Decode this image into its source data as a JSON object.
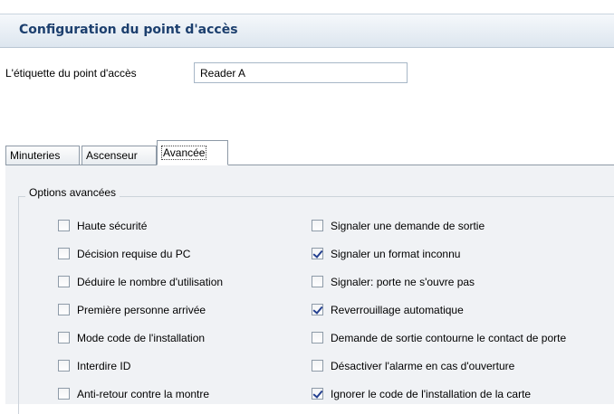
{
  "header": {
    "title": "Configuration du point d'accès"
  },
  "access_point": {
    "label": "L'étiquette du point d'accès",
    "value": "Reader A"
  },
  "tabs": [
    {
      "label": "Minuteries",
      "active": false
    },
    {
      "label": "Ascenseur",
      "active": false
    },
    {
      "label": "Avancée",
      "active": true
    }
  ],
  "group": {
    "title": "Options avancées"
  },
  "options_left": [
    {
      "label": "Haute sécurité",
      "checked": false
    },
    {
      "label": "Décision requise du PC",
      "checked": false
    },
    {
      "label": "Déduire le nombre d'utilisation",
      "checked": false
    },
    {
      "label": "Première personne arrivée",
      "checked": false
    },
    {
      "label": "Mode code de l'installation",
      "checked": false
    },
    {
      "label": "Interdire ID",
      "checked": false
    },
    {
      "label": "Anti-retour contre la montre",
      "checked": false
    }
  ],
  "options_right": [
    {
      "label": "Signaler une demande de sortie",
      "checked": false
    },
    {
      "label": "Signaler un format inconnu",
      "checked": true
    },
    {
      "label": "Signaler: porte ne s'ouvre pas",
      "checked": false
    },
    {
      "label": "Reverrouillage automatique",
      "checked": true
    },
    {
      "label": "Demande de sortie contourne le contact de porte",
      "checked": false
    },
    {
      "label": "Désactiver l'alarme en cas d'ouverture",
      "checked": false
    },
    {
      "label": "Ignorer le code de l'installation de la carte",
      "checked": true
    }
  ],
  "colors": {
    "header_text": "#1c3f6e",
    "checkmark": "#24408f",
    "panel_bg": "#f0f2f5"
  }
}
